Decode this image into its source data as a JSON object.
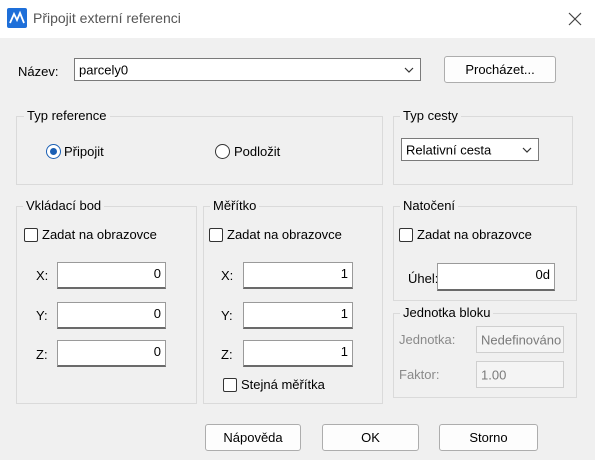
{
  "window": {
    "title": "Připojit externí referenci"
  },
  "name_row": {
    "label": "Název:",
    "value": "parcely0",
    "browse_button": "Procházet..."
  },
  "reference_type": {
    "title": "Typ reference",
    "options": [
      "Připojit",
      "Podložit"
    ],
    "selected": "Připojit"
  },
  "path_type": {
    "title": "Typ cesty",
    "value": "Relativní cesta"
  },
  "insertion_point": {
    "title": "Vkládací bod",
    "on_screen_label": "Zadat na obrazovce",
    "on_screen_checked": false,
    "x_label": "X:",
    "x_value": "0",
    "y_label": "Y:",
    "y_value": "0",
    "z_label": "Z:",
    "z_value": "0"
  },
  "scale": {
    "title": "Měřítko",
    "on_screen_label": "Zadat na obrazovce",
    "on_screen_checked": false,
    "x_label": "X:",
    "x_value": "1",
    "y_label": "Y:",
    "y_value": "1",
    "z_label": "Z:",
    "z_value": "1",
    "uniform_label": "Stejná měřítka",
    "uniform_checked": false
  },
  "rotation": {
    "title": "Natočení",
    "on_screen_label": "Zadat na obrazovce",
    "on_screen_checked": false,
    "angle_label": "Úhel:",
    "angle_value": "0d"
  },
  "block_unit": {
    "title": "Jednotka bloku",
    "unit_label": "Jednotka:",
    "unit_value": "Nedefinováno",
    "factor_label": "Faktor:",
    "factor_value": "1.00"
  },
  "footer": {
    "help": "Nápověda",
    "ok": "OK",
    "cancel": "Storno"
  },
  "colors": {
    "accent": "#1a5fb4",
    "background": "#f0f0f0"
  }
}
